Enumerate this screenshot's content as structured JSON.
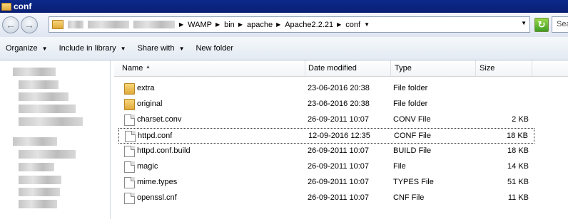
{
  "window": {
    "title": "conf"
  },
  "address": {
    "crumbs": [
      "WAMP",
      "bin",
      "apache",
      "Apache2.2.21",
      "conf"
    ],
    "search_placeholder": "Sea"
  },
  "toolbar": {
    "organize": "Organize",
    "include": "Include in library",
    "share": "Share with",
    "new_folder": "New folder"
  },
  "columns": {
    "name": "Name",
    "date": "Date modified",
    "type": "Type",
    "size": "Size"
  },
  "files": [
    {
      "name": "extra",
      "date": "23-06-2016 20:38",
      "type": "File folder",
      "size": "",
      "icon": "folder-icon"
    },
    {
      "name": "original",
      "date": "23-06-2016 20:38",
      "type": "File folder",
      "size": "",
      "icon": "folder-icon"
    },
    {
      "name": "charset.conv",
      "date": "26-09-2011 10:07",
      "type": "CONV File",
      "size": "2 KB",
      "icon": "file-icon"
    },
    {
      "name": "httpd.conf",
      "date": "12-09-2016 12:35",
      "type": "CONF File",
      "size": "18 KB",
      "icon": "file-icon"
    },
    {
      "name": "httpd.conf.build",
      "date": "26-09-2011 10:07",
      "type": "BUILD File",
      "size": "18 KB",
      "icon": "file-icon"
    },
    {
      "name": "magic",
      "date": "26-09-2011 10:07",
      "type": "File",
      "size": "14 KB",
      "icon": "file-icon"
    },
    {
      "name": "mime.types",
      "date": "26-09-2011 10:07",
      "type": "TYPES File",
      "size": "51 KB",
      "icon": "file-icon"
    },
    {
      "name": "openssl.cnf",
      "date": "26-09-2011 10:07",
      "type": "CNF File",
      "size": "11 KB",
      "icon": "file-icon"
    }
  ]
}
